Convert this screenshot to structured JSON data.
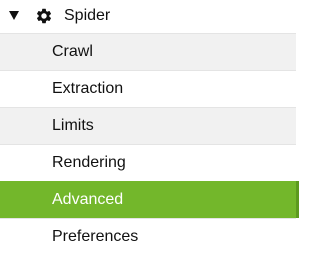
{
  "tree": {
    "header": {
      "caret_icon": "caret-down-icon",
      "node_icon": "gear-icon",
      "label": "Spider"
    },
    "items": [
      {
        "label": "Crawl",
        "selected": false
      },
      {
        "label": "Extraction",
        "selected": false
      },
      {
        "label": "Limits",
        "selected": false
      },
      {
        "label": "Rendering",
        "selected": false
      },
      {
        "label": "Advanced",
        "selected": true
      },
      {
        "label": "Preferences",
        "selected": false
      }
    ]
  },
  "colors": {
    "selected_bg": "#73b72b",
    "stripe_bg": "#f1f1f1",
    "text": "#111111"
  }
}
